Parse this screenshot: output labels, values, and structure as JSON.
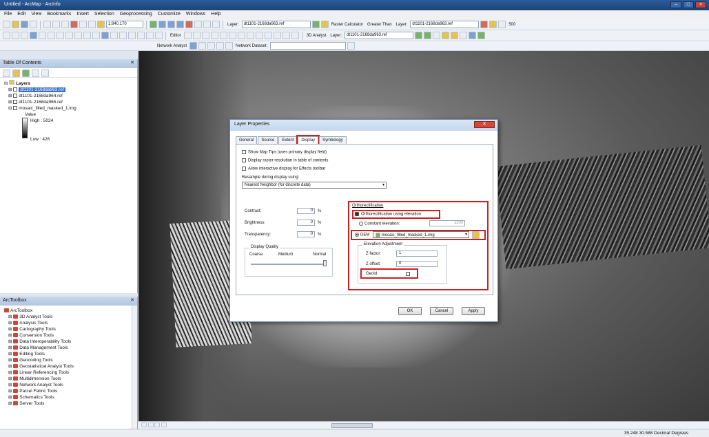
{
  "window": {
    "title": "Untitled - ArcMap - ArcInfo"
  },
  "menu": [
    "File",
    "Edit",
    "View",
    "Bookmarks",
    "Insert",
    "Selection",
    "Geoprocessing",
    "Customize",
    "Windows",
    "Help"
  ],
  "toolbar1": {
    "scale": "1:840,170",
    "layer_label": "Layer:",
    "layer_value": "dt1101-2168da963.ref",
    "raster_calc": "Raster Calculator",
    "greater_than": "Greater Than",
    "layer2_label": "Layer:",
    "layer2_value": "dt1101-2168da963.ref",
    "zoom": "500"
  },
  "toolbar2": {
    "analyst3d": "3D Analyst",
    "layer_label": "Layer:",
    "layer_value": "dt1101-2168da963.ref",
    "editor": "Editor"
  },
  "toolbar3": {
    "network_analyst": "Network Analyst",
    "network_dataset": "Network Dataset:"
  },
  "toc": {
    "title": "Table Of Contents",
    "root": "Layers",
    "layers": [
      "dt1101-2168da963.ref",
      "dt1101-2168da964.ref",
      "dt1101-2168da965.ref",
      "mosaic_filled_masked_1.img"
    ],
    "value_label": "Value",
    "high": "High : 5024",
    "low": "Low : 426"
  },
  "toolbox": {
    "title": "ArcToolbox",
    "root": "ArcToolbox",
    "items": [
      "3D Analyst Tools",
      "Analysis Tools",
      "Cartography Tools",
      "Conversion Tools",
      "Data Interoperability Tools",
      "Data Management Tools",
      "Editing Tools",
      "Geocoding Tools",
      "Geostatistical Analyst Tools",
      "Linear Referencing Tools",
      "Multidimension Tools",
      "Network Analyst Tools",
      "Parcel Fabric Tools",
      "Schematics Tools",
      "Server Tools"
    ]
  },
  "dialog": {
    "title": "Layer Properties",
    "tabs": [
      "General",
      "Source",
      "Extent",
      "Display",
      "Symbology"
    ],
    "active_tab": "Display",
    "checks": [
      "Show Map Tips (uses primary display field)",
      "Display raster resolution in table of contents",
      "Allow interactive display for Effects toolbar"
    ],
    "resample_label": "Resample during display using:",
    "resample_value": "Nearest Neighbor (for discrete data)",
    "contrast_label": "Contrast:",
    "contrast_value": "0",
    "brightness_label": "Brightness:",
    "brightness_value": "0",
    "transparency_label": "Transparency:",
    "transparency_value": "0",
    "pct": "%",
    "quality": {
      "title": "Display Quality",
      "coarse": "Coarse",
      "medium": "Medium",
      "normal": "Normal",
      "level": 1.0
    },
    "ortho": {
      "title": "Orthorectification",
      "use_elevation": "Orthorectification using elevation",
      "constant_label": "Constant elevation:",
      "constant_value": "1100",
      "dem_label": "DEM",
      "dem_value": "mosaic_filled_masked_1.img",
      "elev_adj": "Elevation Adjustment",
      "zfactor_label": "Z factor:",
      "zfactor_value": "1",
      "zoffset_label": "Z offset:",
      "zoffset_value": "0",
      "geoid_label": "Geoid:"
    },
    "ok": "OK",
    "cancel": "Cancel",
    "apply": "Apply"
  },
  "status": {
    "coords": "35.248  30.588 Decimal Degrees"
  },
  "colors": {
    "highlight": "#d11e1e",
    "selection": "#3a6fc4"
  }
}
